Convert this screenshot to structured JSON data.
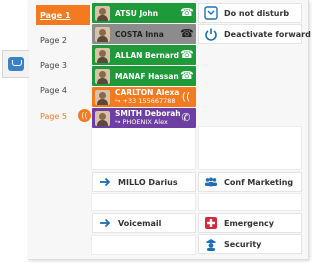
{
  "pages": [
    {
      "label": "Page 1",
      "active": true
    },
    {
      "label": "Page 2"
    },
    {
      "label": "Page 3"
    },
    {
      "label": "Page 4"
    },
    {
      "label": "Page 5",
      "alert": true
    }
  ],
  "contacts": [
    {
      "name": "ATSU John",
      "color": "#1f9a3a"
    },
    {
      "name": "COSTA Inna",
      "color": "#8c8c8c"
    },
    {
      "name": "ALLAN Bernard",
      "color": "#1f9a3a"
    },
    {
      "name": "MANAF Hassan",
      "color": "#1f9a3a"
    },
    {
      "name": "CARLTON Alexandr...",
      "sub": "+33 155667788",
      "color": "#f47a20"
    },
    {
      "name": "SMITH Deborah",
      "sub": "PHOENIX Alex",
      "color": "#6e3fa3"
    }
  ],
  "functions": {
    "do_not_disturb": "Do not disturb",
    "deactivate_forward": "Deactivate forward",
    "millo": "MILLO Darius",
    "conf_marketing": "Conf Marketing",
    "voicemail": "Voicemail",
    "emergency": "Emergency",
    "security": "Security"
  },
  "colors": {
    "accent": "#f47a20",
    "green": "#1f9a3a",
    "purple": "#6e3fa3",
    "blue": "#1e6fb5",
    "red": "#d9263b"
  }
}
